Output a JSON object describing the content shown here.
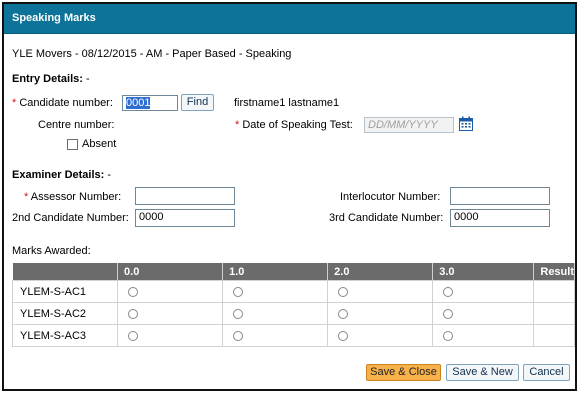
{
  "dialog": {
    "title": "Speaking Marks"
  },
  "session": {
    "info": "YLE Movers - 08/12/2015 - AM - Paper Based - Speaking"
  },
  "entry": {
    "heading": "Entry Details:",
    "heading_suffix": "-",
    "candidate_number": {
      "required": "*",
      "label": "Candidate number:",
      "value": "0001",
      "find_label": "Find"
    },
    "candidate_name": "firstname1 lastname1",
    "centre_number": {
      "label": "Centre number:",
      "value": ""
    },
    "speaking_date": {
      "required": "*",
      "label": "Date of Speaking Test:",
      "placeholder": "DD/MM/YYYY",
      "icon": "calendar-icon"
    },
    "absent": {
      "label": "Absent",
      "checked": false
    }
  },
  "examiner": {
    "heading": "Examiner Details:",
    "heading_suffix": "-",
    "assessor": {
      "required": "*",
      "label": "Assessor Number:",
      "value": ""
    },
    "interlocutor": {
      "label": "Interlocutor Number:",
      "value": ""
    },
    "second_candidate": {
      "label": "2nd Candidate Number:",
      "value": "0000"
    },
    "third_candidate": {
      "label": "3rd Candidate Number:",
      "value": "0000"
    }
  },
  "marks": {
    "label": "Marks Awarded:",
    "columns": [
      "",
      "0.0",
      "1.0",
      "2.0",
      "3.0",
      "Result"
    ],
    "rows": [
      "YLEM-S-AC1",
      "YLEM-S-AC2",
      "YLEM-S-AC3"
    ]
  },
  "buttons": {
    "save_close": "Save & Close",
    "save_new": "Save & New",
    "cancel": "Cancel"
  },
  "colors": {
    "titlebar": "#0d7398",
    "header_row": "#6b6b6b",
    "primary_button": "#f7b14a",
    "required": "#d01818"
  }
}
